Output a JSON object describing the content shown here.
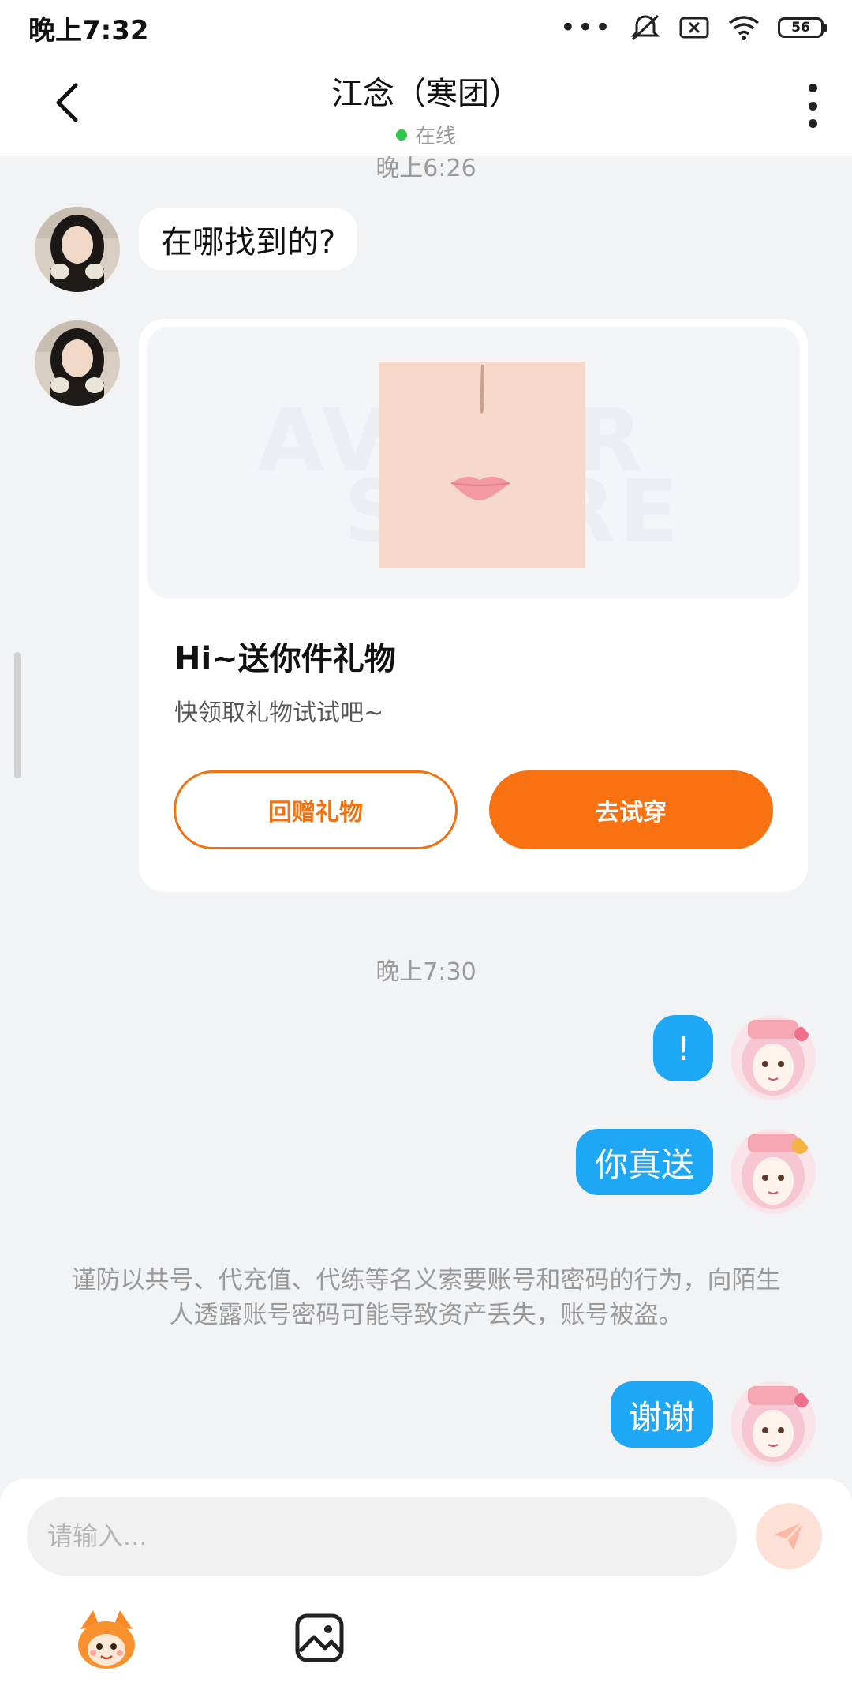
{
  "status_bar": {
    "time": "晚上7:32",
    "battery": "56",
    "dots": "•••"
  },
  "header": {
    "title": "江念（寒团）",
    "status": "在线"
  },
  "messages": {
    "ts_top": "晚上6:26",
    "m1_text": "在哪找到的?",
    "gift": {
      "title": "Hi~送你件礼物",
      "subtitle": "快领取礼物试试吧~",
      "btn_return": "回赠礼物",
      "btn_try": "去试穿",
      "watermark_1": "AVATAR",
      "watermark_2": "STORE"
    },
    "ts_mid": "晚上7:30",
    "r1_text": "!",
    "r2_text": "你真送",
    "notice": "谨防以共号、代充值、代练等名义索要账号和密码的行为，向陌生人透露账号密码可能导致资产丢失，账号被盗。",
    "r3_text": "谢谢"
  },
  "input": {
    "placeholder": "请输入..."
  },
  "colors": {
    "accent_orange": "#f97212",
    "bubble_blue": "#1ea7f5",
    "online_green": "#2cc84a"
  },
  "icons": [
    "back-icon",
    "more-icon",
    "send-icon",
    "emoji-mascot-icon",
    "image-icon",
    "wifi-icon",
    "mute-icon",
    "sim-icon"
  ]
}
